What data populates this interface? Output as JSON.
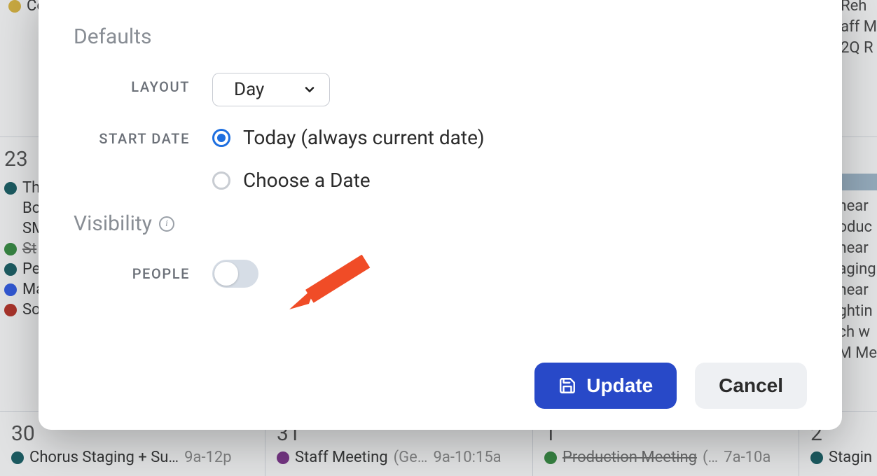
{
  "background": {
    "top": {
      "left_event": "Co",
      "right_frags": [
        "Reh",
        "aff M",
        "2Q R"
      ]
    },
    "row23": {
      "day": "23",
      "events": [
        {
          "color": "#0f5a60",
          "label": "Th"
        },
        {
          "color": "",
          "label": "Bo"
        },
        {
          "color": "",
          "label": "SM"
        },
        {
          "color": "#2f8a3b",
          "label": "St",
          "strike": true
        },
        {
          "color": "#0f5a60",
          "label": "Pe"
        },
        {
          "color": "#2956e8",
          "label": "Ma"
        },
        {
          "color": "#b72a1f",
          "label": "So"
        }
      ],
      "right_frags": [
        "hear",
        "oduc",
        "hear",
        "aging",
        "hear",
        "ghtin",
        "ch w",
        "M Me"
      ],
      "right_highlight": true
    },
    "row30": {
      "cells": [
        {
          "day": "30",
          "color": "#0f5a60",
          "label": "Chorus Staging + Su…",
          "time": "9a-12p"
        },
        {
          "day": "31",
          "color": "#7a2d8a",
          "label": "Staff Meeting",
          "note": "(Ge…",
          "time": "9a-10:15a"
        },
        {
          "day": "1",
          "color": "#2f8a3b",
          "label": "Production Meeting",
          "note": "(…",
          "time": "7a-10a",
          "strike": true
        },
        {
          "day": "2",
          "color": "#0f5a60",
          "label": "Stagin"
        }
      ]
    }
  },
  "modal": {
    "sections": {
      "defaults": "Defaults",
      "visibility": "Visibility"
    },
    "labels": {
      "layout": "LAYOUT",
      "start_date": "START DATE",
      "people": "PEOPLE"
    },
    "layout_select": {
      "value": "Day"
    },
    "start_date": {
      "today": "Today (always current date)",
      "choose": "Choose a Date",
      "selected": "today"
    },
    "people_toggle": false,
    "buttons": {
      "update": "Update",
      "cancel": "Cancel"
    }
  }
}
